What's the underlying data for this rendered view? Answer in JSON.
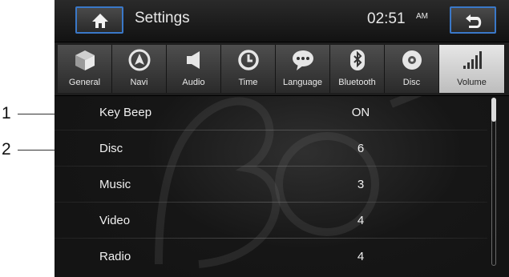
{
  "callouts": [
    {
      "number": "1"
    },
    {
      "number": "2"
    }
  ],
  "header": {
    "title": "Settings",
    "time": "02:51",
    "ampm": "AM",
    "home_icon": "home-icon",
    "back_icon": "back-arrow-icon"
  },
  "tabs": [
    {
      "label": "General",
      "icon": "cube-icon",
      "active": false
    },
    {
      "label": "Navi",
      "icon": "compass-icon",
      "active": false
    },
    {
      "label": "Audio",
      "icon": "speaker-icon",
      "active": false
    },
    {
      "label": "Time",
      "icon": "clock-icon",
      "active": false
    },
    {
      "label": "Language",
      "icon": "speech-bubble-icon",
      "active": false
    },
    {
      "label": "Bluetooth",
      "icon": "bluetooth-icon",
      "active": false
    },
    {
      "label": "Disc",
      "icon": "disc-icon",
      "active": false
    },
    {
      "label": "Volume",
      "icon": "volume-bars-icon",
      "active": true
    }
  ],
  "rows": [
    {
      "label": "Key Beep",
      "value": "ON"
    },
    {
      "label": "Disc",
      "value": "6"
    },
    {
      "label": "Music",
      "value": "3"
    },
    {
      "label": "Video",
      "value": "4"
    },
    {
      "label": "Radio",
      "value": "4"
    }
  ],
  "colors": {
    "accent_border": "#3a78c8",
    "active_tab": "#d8d8d8",
    "background": "#141414"
  }
}
